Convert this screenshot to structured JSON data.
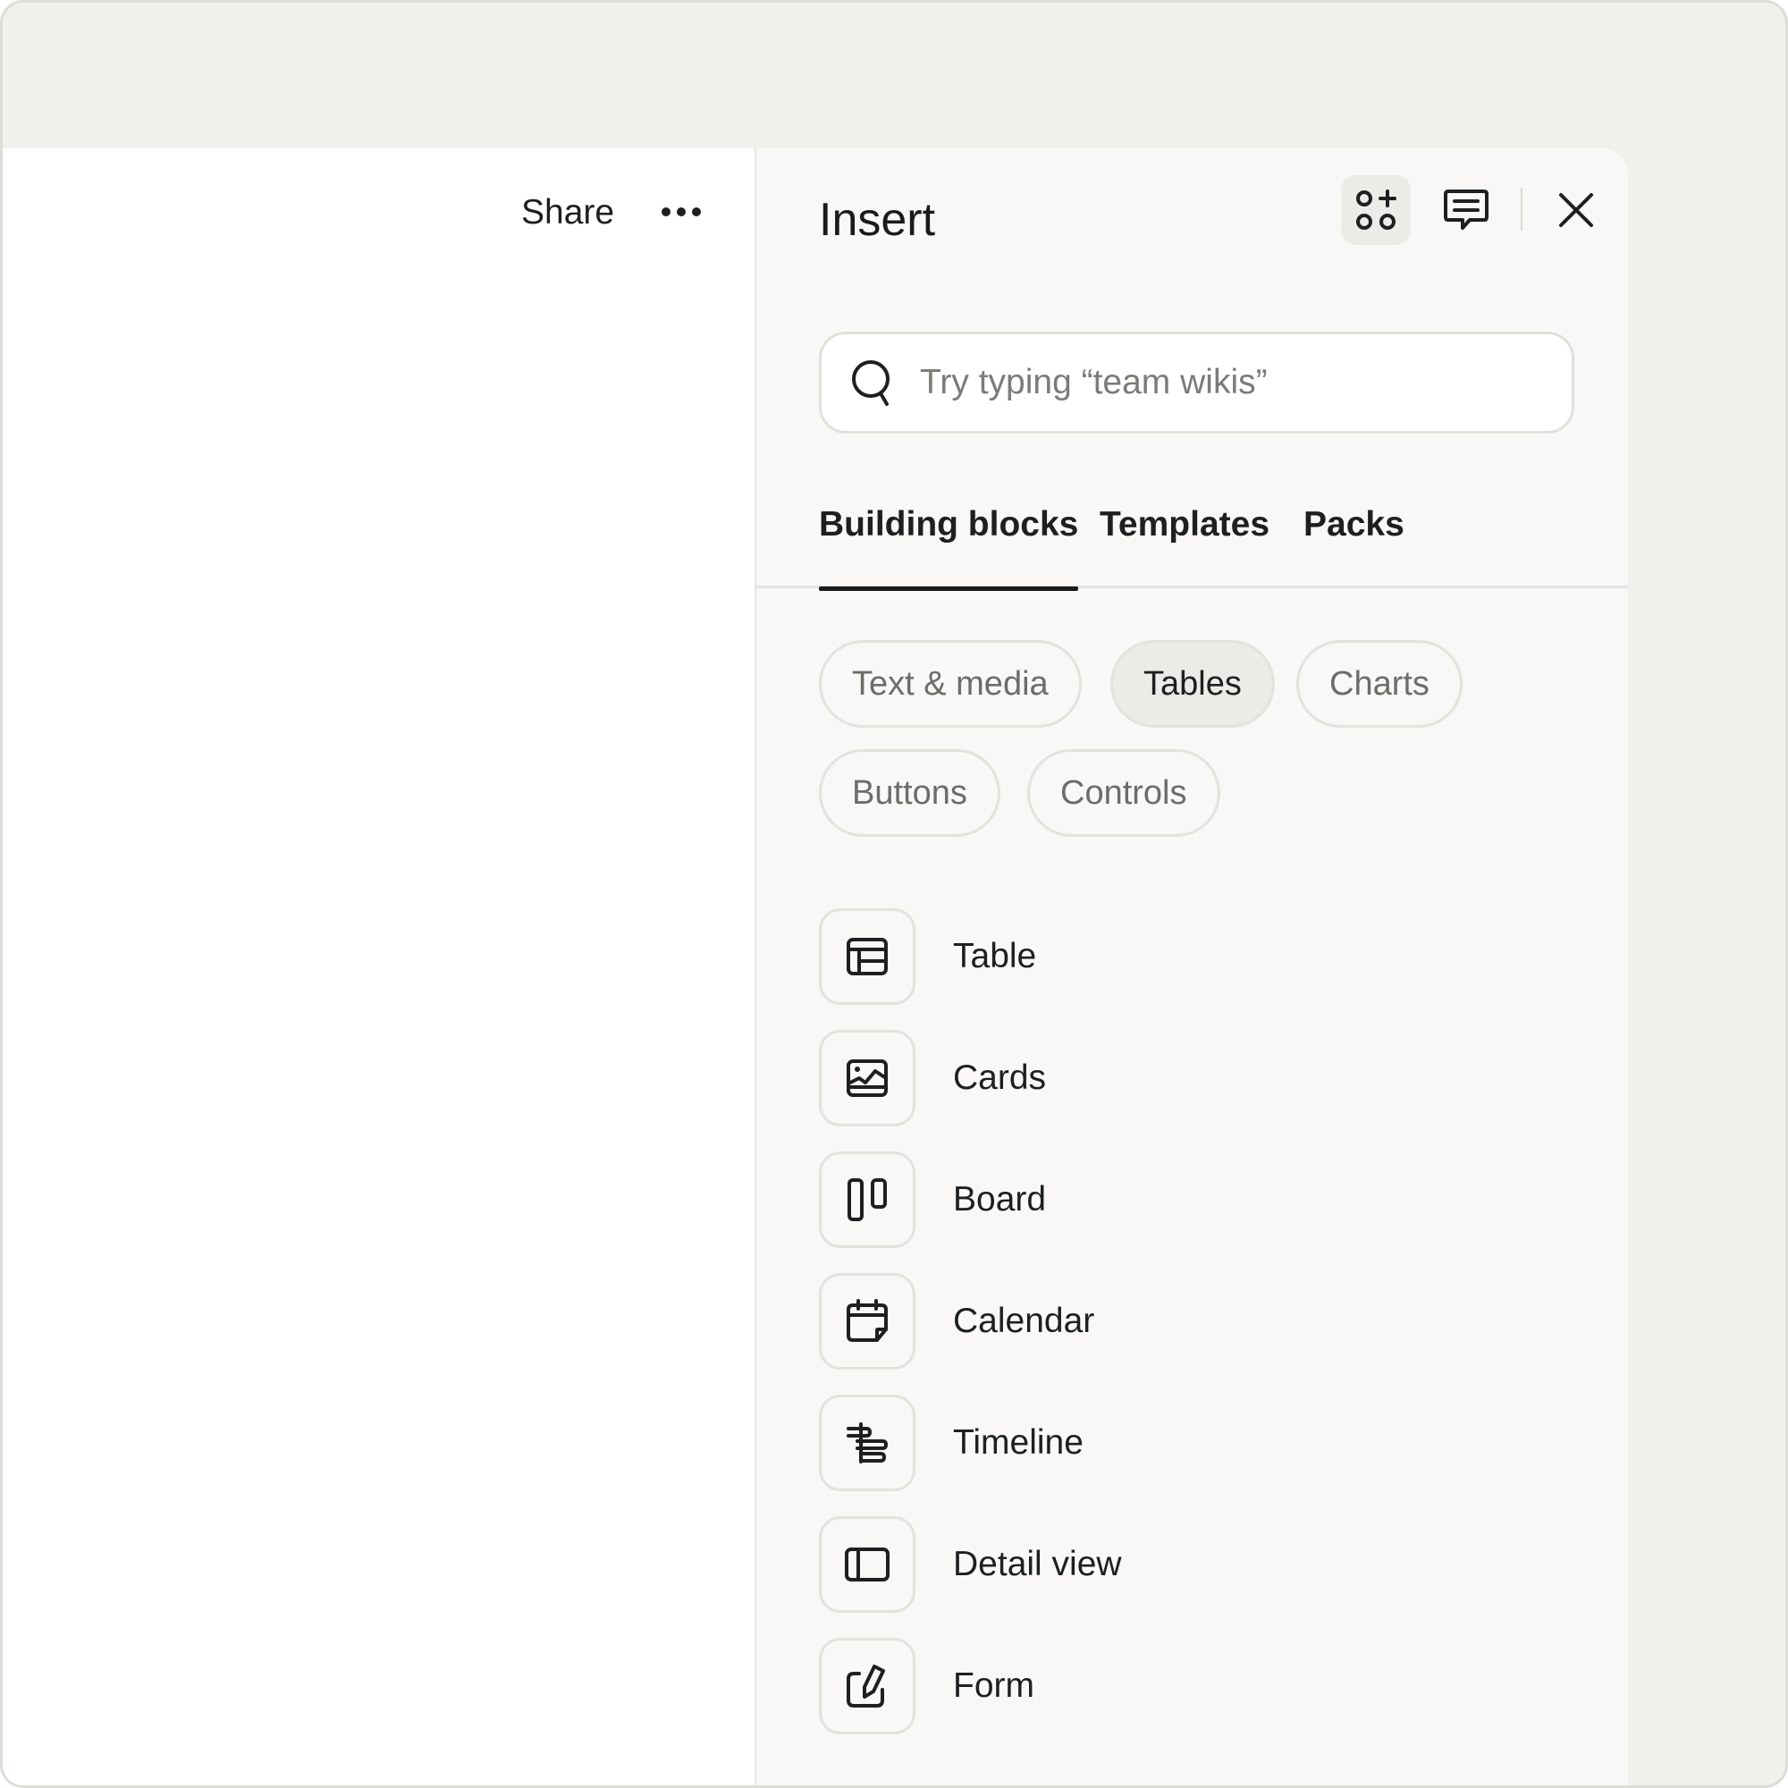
{
  "document": {
    "share_label": "Share",
    "more_label": "More options"
  },
  "panel": {
    "title": "Insert",
    "header_buttons": [
      "insert-blocks",
      "comments",
      "close"
    ],
    "search": {
      "placeholder": "Try typing “team wikis”",
      "value": ""
    },
    "tabs": [
      {
        "label": "Building blocks",
        "active": true
      },
      {
        "label": "Templates",
        "active": false
      },
      {
        "label": "Packs",
        "active": false
      }
    ],
    "categories": [
      {
        "label": "Text & media",
        "selected": false
      },
      {
        "label": "Tables",
        "selected": true
      },
      {
        "label": "Charts",
        "selected": false
      },
      {
        "label": "Buttons",
        "selected": false
      },
      {
        "label": "Controls",
        "selected": false
      }
    ],
    "items": [
      {
        "label": "Table",
        "icon": "table-icon"
      },
      {
        "label": "Cards",
        "icon": "cards-icon"
      },
      {
        "label": "Board",
        "icon": "board-icon"
      },
      {
        "label": "Calendar",
        "icon": "calendar-icon"
      },
      {
        "label": "Timeline",
        "icon": "timeline-icon"
      },
      {
        "label": "Detail view",
        "icon": "detail-view-icon"
      },
      {
        "label": "Form",
        "icon": "form-icon"
      }
    ]
  },
  "colors": {
    "background": "#f1f0ec",
    "panel": "#f9f8f6",
    "border": "#e4e2dd",
    "text": "#1f1f1f",
    "muted_text": "#6e6c68",
    "selected_chip": "#ecebe7"
  }
}
